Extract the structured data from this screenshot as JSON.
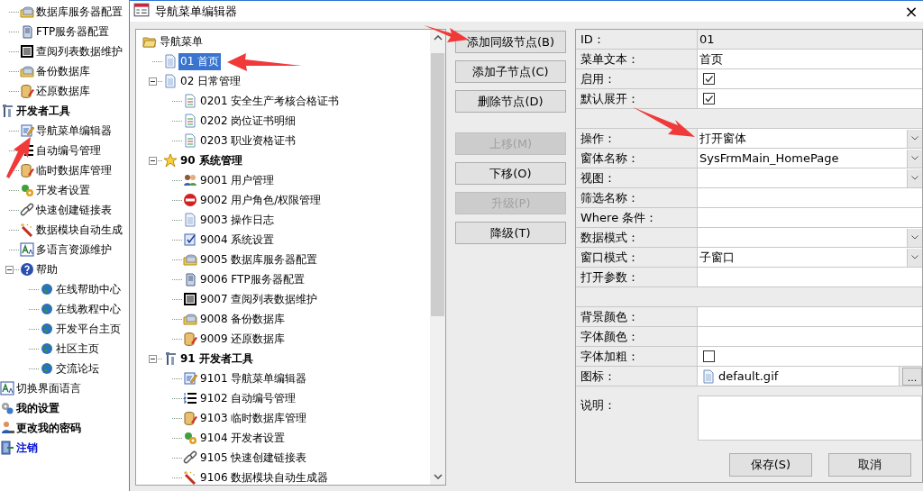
{
  "left_nav": {
    "partial_children": [
      {
        "label": "数据库服务器配置"
      },
      {
        "label": "FTP服务器配置"
      },
      {
        "label": "查阅列表数据维护"
      },
      {
        "label": "备份数据库"
      },
      {
        "label": "还原数据库"
      }
    ],
    "items": [
      {
        "label": "开发者工具",
        "bold": true,
        "link": false,
        "children": [
          {
            "label": "导航菜单编辑器"
          },
          {
            "label": "自动编号管理"
          },
          {
            "label": "临时数据库管理"
          },
          {
            "label": "开发者设置"
          },
          {
            "label": "快速创建链接表"
          },
          {
            "label": "数据模块自动生成"
          },
          {
            "label": "多语言资源维护"
          }
        ]
      },
      {
        "label": "帮助",
        "bold": false,
        "link": false,
        "expanded": true,
        "children": [
          {
            "label": "在线帮助中心"
          },
          {
            "label": "在线教程中心"
          },
          {
            "label": "开发平台主页"
          },
          {
            "label": "社区主页"
          },
          {
            "label": "交流论坛"
          }
        ]
      },
      {
        "label": "切换界面语言",
        "bold": false,
        "link": false
      },
      {
        "label": "我的设置",
        "bold": true,
        "link": false
      },
      {
        "label": "更改我的密码",
        "bold": true,
        "link": false
      },
      {
        "label": "注销",
        "bold": true,
        "link": true
      }
    ]
  },
  "window": {
    "title": "导航菜单编辑器",
    "close": "×"
  },
  "menu_tree": {
    "label": "导航菜单",
    "selected": false,
    "bold": false,
    "children": [
      {
        "label": "01 首页",
        "selected": true,
        "bold": false
      },
      {
        "label": "02 日常管理",
        "selected": false,
        "bold": false,
        "expanded": true,
        "children": [
          {
            "label": "0201 安全生产考核合格证书",
            "selected": false,
            "bold": false
          },
          {
            "label": "0202 岗位证书明细",
            "selected": false,
            "bold": false
          },
          {
            "label": "0203 职业资格证书",
            "selected": false,
            "bold": false
          }
        ]
      },
      {
        "label": "90 系统管理",
        "selected": false,
        "bold": true,
        "expanded": true,
        "children": [
          {
            "label": "9001 用户管理",
            "selected": false,
            "bold": false
          },
          {
            "label": "9002 用户角色/权限管理",
            "selected": false,
            "bold": false
          },
          {
            "label": "9003 操作日志",
            "selected": false,
            "bold": false
          },
          {
            "label": "9004 系统设置",
            "selected": false,
            "bold": false
          },
          {
            "label": "9005 数据库服务器配置",
            "selected": false,
            "bold": false
          },
          {
            "label": "9006 FTP服务器配置",
            "selected": false,
            "bold": false
          },
          {
            "label": "9007 查阅列表数据维护",
            "selected": false,
            "bold": false
          },
          {
            "label": "9008 备份数据库",
            "selected": false,
            "bold": false
          },
          {
            "label": "9009 还原数据库",
            "selected": false,
            "bold": false
          }
        ]
      },
      {
        "label": "91 开发者工具",
        "selected": false,
        "bold": true,
        "expanded": true,
        "children": [
          {
            "label": "9101 导航菜单编辑器",
            "selected": false,
            "bold": false
          },
          {
            "label": "9102 自动编号管理",
            "selected": false,
            "bold": false
          },
          {
            "label": "9103 临时数据库管理",
            "selected": false,
            "bold": false
          },
          {
            "label": "9104 开发者设置",
            "selected": false,
            "bold": false
          },
          {
            "label": "9105 快速创建链接表",
            "selected": false,
            "bold": false
          },
          {
            "label": "9106 数据模块自动生成器",
            "selected": false,
            "bold": false
          }
        ]
      }
    ]
  },
  "node_actions": [
    {
      "label": "添加同级节点(B)",
      "disabled": false
    },
    {
      "label": "添加子节点(C)",
      "disabled": false
    },
    {
      "label": "删除节点(D)",
      "disabled": false
    }
  ],
  "move_actions": [
    {
      "label": "上移(M)",
      "disabled": true
    },
    {
      "label": "下移(O)",
      "disabled": false
    },
    {
      "label": "升级(P)",
      "disabled": true
    },
    {
      "label": "降级(T)",
      "disabled": false
    }
  ],
  "properties": [
    {
      "kind": "readonly",
      "label": "ID：",
      "value": "01"
    },
    {
      "kind": "text",
      "label": "菜单文本：",
      "value": "首页"
    },
    {
      "kind": "check",
      "label": "启用：",
      "checked": true
    },
    {
      "kind": "check",
      "label": "默认展开：",
      "checked": true
    },
    {
      "kind": "blank"
    },
    {
      "kind": "combo",
      "label": "操作：",
      "value": "打开窗体"
    },
    {
      "kind": "combo",
      "label": "窗体名称：",
      "value": "SysFrmMain_HomePage"
    },
    {
      "kind": "combo",
      "label": "视图："
    },
    {
      "kind": "text",
      "label": "筛选名称："
    },
    {
      "kind": "text",
      "label": "Where 条件："
    },
    {
      "kind": "combo",
      "label": "数据模式："
    },
    {
      "kind": "combo",
      "label": "窗口模式：",
      "value": "子窗口"
    },
    {
      "kind": "text",
      "label": "打开参数："
    },
    {
      "kind": "blank"
    },
    {
      "kind": "text",
      "label": "背景颜色："
    },
    {
      "kind": "text",
      "label": "字体颜色："
    },
    {
      "kind": "check",
      "label": "字体加粗：",
      "checked": false
    },
    {
      "kind": "file",
      "label": "图标：",
      "value": "default.gif",
      "button": "..."
    },
    {
      "kind": "memo",
      "label": "说明："
    }
  ],
  "dialog_buttons": [
    "保存(S)",
    "取消"
  ]
}
